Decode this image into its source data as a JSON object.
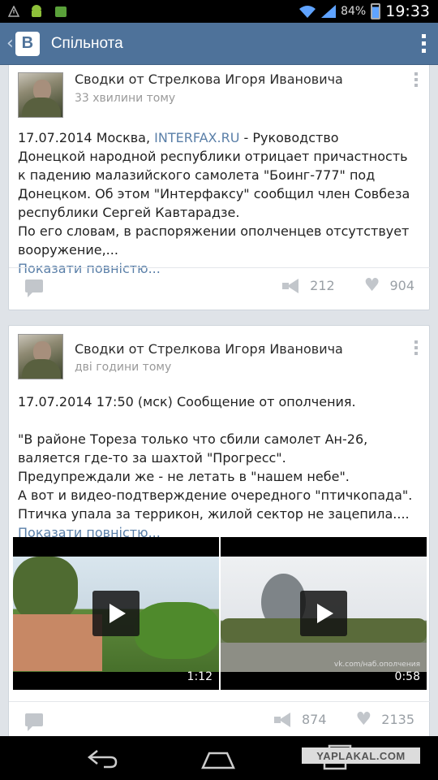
{
  "status_bar": {
    "battery": "84%",
    "time": "19:33"
  },
  "action_bar": {
    "logo": "В",
    "title": "Спільнота"
  },
  "posts": [
    {
      "author": "Сводки от Стрелкова Игоря Ивановича",
      "time": "33 хвилини тому",
      "lines": [
        {
          "before": "17.07.2014 Москва, ",
          "link": "INTERFAX.RU",
          "after": " - Руководство"
        },
        {
          "text": "Донецкой народной республики отрицает причастность"
        },
        {
          "text": "к падению малазийского самолета \"Боинг-777\" под"
        },
        {
          "text": "Донецком. Об этом \"Интерфаксу\" сообщил член Совбеза"
        },
        {
          "text": "республики Сергей Кавтарадзе."
        },
        {
          "text": "По его словам, в распоряжении ополченцев отсутствует"
        },
        {
          "text": "вооружение,..."
        }
      ],
      "show_more": "Показати повністю...",
      "reposts": "212",
      "likes": "904"
    },
    {
      "author": "Сводки от Стрелкова Игоря Ивановича",
      "time": "дві години тому",
      "lines": [
        {
          "text": "17.07.2014 17:50 (мск) Сообщение от ополчения."
        },
        {
          "text": ""
        },
        {
          "text": "\"В районе Тореза только что сбили самолет Ан-26,"
        },
        {
          "text": "валяется где-то за шахтой \"Прогресс\"."
        },
        {
          "text": "Предупреждали же - не летать в \"нашем небе\"."
        },
        {
          "text": "А вот и видео-подтверждение очередного \"птичкопада\"."
        },
        {
          "text": "Птичка упала за террикон, жилой сектор не зацепила...."
        }
      ],
      "show_more": "Показати повністю...",
      "videos": [
        {
          "duration": "1:12"
        },
        {
          "duration": "0:58",
          "watermark": "vk.com/наб.ополчения"
        }
      ],
      "reposts": "874",
      "likes": "2135"
    }
  ],
  "watermark": "YAPLAKAL.COM",
  "colors": {
    "action_bar": "#4e729a",
    "link": "#5a7fa8",
    "background": "#dfe3e8"
  }
}
